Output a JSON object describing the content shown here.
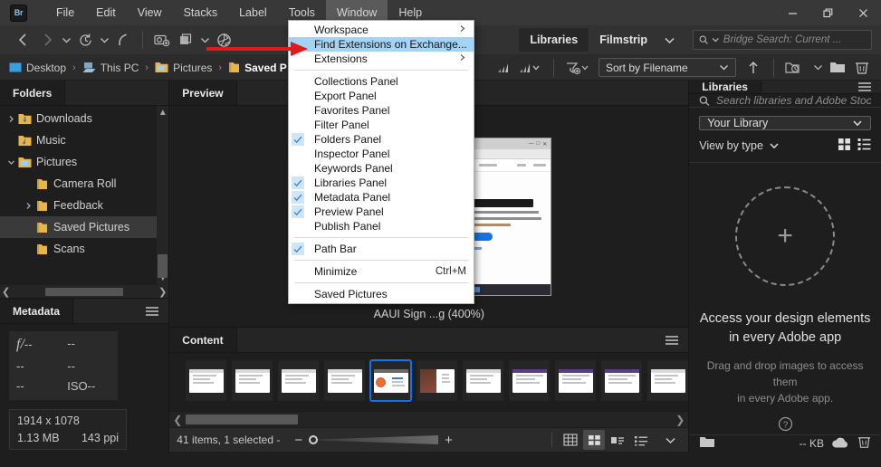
{
  "app": {
    "logo": "Br"
  },
  "menubar": {
    "items": [
      {
        "label": "File",
        "active": false
      },
      {
        "label": "Edit",
        "active": false
      },
      {
        "label": "View",
        "active": false
      },
      {
        "label": "Stacks",
        "active": false
      },
      {
        "label": "Label",
        "active": false
      },
      {
        "label": "Tools",
        "active": false
      },
      {
        "label": "Window",
        "active": true
      },
      {
        "label": "Help",
        "active": false
      }
    ]
  },
  "window_controls": {
    "minimize": "minimize-icon",
    "restore": "restore-icon",
    "close": "close-icon"
  },
  "window_menu": {
    "items": [
      {
        "label": "Workspace",
        "submenu": true,
        "checked": false,
        "highlighted": false
      },
      {
        "label": "Find Extensions on Exchange...",
        "submenu": false,
        "checked": false,
        "highlighted": true
      },
      {
        "label": "Extensions",
        "submenu": true,
        "checked": false,
        "highlighted": false
      },
      {
        "divider": true
      },
      {
        "label": "Collections Panel",
        "checked": false
      },
      {
        "label": "Export Panel",
        "checked": false
      },
      {
        "label": "Favorites Panel",
        "checked": false
      },
      {
        "label": "Filter Panel",
        "checked": false
      },
      {
        "label": "Folders Panel",
        "checked": true
      },
      {
        "label": "Inspector Panel",
        "checked": false
      },
      {
        "label": "Keywords Panel",
        "checked": false
      },
      {
        "label": "Libraries Panel",
        "checked": true
      },
      {
        "label": "Metadata Panel",
        "checked": true
      },
      {
        "label": "Preview Panel",
        "checked": true
      },
      {
        "label": "Publish Panel",
        "checked": false
      },
      {
        "divider": true
      },
      {
        "label": "Path Bar",
        "checked": true
      },
      {
        "divider": true
      },
      {
        "label": "Minimize",
        "checked": false,
        "accel": "Ctrl+M"
      },
      {
        "divider": true
      },
      {
        "label": "Saved Pictures",
        "checked": false
      }
    ]
  },
  "toolbar": {
    "icons": [
      {
        "name": "back-icon",
        "dim": false
      },
      {
        "name": "forward-icon",
        "dim": true
      },
      {
        "name": "recent-dropdown-icon",
        "dim": false
      },
      {
        "name": "history-icon",
        "dim": false
      },
      {
        "name": "history-dropdown-icon",
        "dim": false
      },
      {
        "name": "boomerang-icon",
        "dim": false
      },
      {
        "name": "get-photos-from-camera-icon",
        "dim": false
      },
      {
        "name": "refine-icon",
        "dim": false
      },
      {
        "name": "refine-dropdown-icon",
        "dim": false
      },
      {
        "name": "open-in-camera-raw-icon",
        "dim": false
      }
    ],
    "workspace_tabs": [
      {
        "label": "Libraries",
        "selected": true
      },
      {
        "label": "Filmstrip",
        "selected": false
      },
      {
        "label": "workspace-more-chevron",
        "selected": false
      }
    ],
    "search": {
      "placeholder": "Bridge Search: Current ...",
      "value": ""
    }
  },
  "pathbar": {
    "crumbs": [
      {
        "label": "Desktop",
        "icon": "desktop-icon",
        "current": false
      },
      {
        "label": "This PC",
        "icon": "this-pc-icon",
        "current": false
      },
      {
        "label": "Pictures",
        "icon": "pictures-folder-icon",
        "current": false
      },
      {
        "label": "Saved P",
        "icon": "folder-icon",
        "current": true
      }
    ],
    "separator": "›",
    "sort_label": "Sort by Filename",
    "right_icons": [
      "filter-icon",
      "filter-dropdown-icon",
      "sort-ascending-icon",
      "new-folder-recent-icon",
      "new-folder-dropdown-icon",
      "new-folder-icon",
      "delete-icon"
    ]
  },
  "folders_panel": {
    "tab": "Folders",
    "items": [
      {
        "label": "Downloads",
        "arrow": "collapsed",
        "icon": "downloads-folder-icon",
        "selected": false,
        "indent": 1
      },
      {
        "label": "Music",
        "arrow": "none",
        "icon": "music-folder-icon",
        "selected": false,
        "indent": 1
      },
      {
        "label": "Pictures",
        "arrow": "expanded",
        "icon": "pictures-folder-icon",
        "selected": false,
        "indent": 1
      },
      {
        "label": "Camera Roll",
        "arrow": "none",
        "icon": "folder-icon",
        "selected": false,
        "indent": 2
      },
      {
        "label": "Feedback",
        "arrow": "collapsed",
        "icon": "folder-icon",
        "selected": false,
        "indent": 2
      },
      {
        "label": "Saved Pictures",
        "arrow": "none",
        "icon": "folder-icon",
        "selected": true,
        "indent": 2
      },
      {
        "label": "Scans",
        "arrow": "none",
        "icon": "folder-icon",
        "selected": false,
        "indent": 2
      }
    ]
  },
  "metadata_panel": {
    "tab": "Metadata",
    "exif": {
      "aperture_label": "f/",
      "aperture": "--",
      "shutter": "--",
      "exposure": "--",
      "bias": "--",
      "flash": "--",
      "iso_label": "ISO",
      "iso": "--"
    },
    "dimensions": "1914 x 1078",
    "filesize": "1.13 MB",
    "resolution": "143 ppi"
  },
  "preview_panel": {
    "tab": "Preview",
    "caption": "AAUI Sign ...g (400%)"
  },
  "content_panel": {
    "tab": "Content",
    "status": "41 items, 1 selected -",
    "thumbnails": [
      {
        "index": 0,
        "selected": false,
        "style": "doc"
      },
      {
        "index": 1,
        "selected": false,
        "style": "doc"
      },
      {
        "index": 2,
        "selected": false,
        "style": "doc"
      },
      {
        "index": 3,
        "selected": false,
        "style": "doc"
      },
      {
        "index": 4,
        "selected": true,
        "style": "photo"
      },
      {
        "index": 5,
        "selected": false,
        "style": "photo-dark"
      },
      {
        "index": 6,
        "selected": false,
        "style": "doc"
      },
      {
        "index": 7,
        "selected": false,
        "style": "purple"
      },
      {
        "index": 8,
        "selected": false,
        "style": "purple"
      },
      {
        "index": 9,
        "selected": false,
        "style": "purple"
      },
      {
        "index": 10,
        "selected": false,
        "style": "doc"
      }
    ],
    "view_icons": [
      {
        "name": "grid-large-icon",
        "active": false
      },
      {
        "name": "grid-icon",
        "active": true
      },
      {
        "name": "details-view-icon",
        "active": false
      },
      {
        "name": "list-view-icon",
        "active": false
      },
      {
        "name": "view-options-chevron-icon",
        "active": false
      }
    ],
    "zoom_minus": "−",
    "zoom_plus": "+"
  },
  "libraries_panel": {
    "tab": "Libraries",
    "search_placeholder": "Search libraries and Adobe Stock",
    "selected_library": "Your Library",
    "view_by": "View by type",
    "heading_line1": "Access your design elements",
    "heading_line2": "in every Adobe app",
    "sub_line1": "Drag and drop images to access them",
    "sub_line2": "in every Adobe app.",
    "plus": "+",
    "footer_size": "-- KB"
  },
  "colors": {
    "accent_blue": "#1473e6",
    "menu_highlight": "#a3d3f5",
    "annotation_red": "#e01b1b",
    "panel_bg": "#1e1e1e",
    "titlebar_bg": "#383838"
  }
}
